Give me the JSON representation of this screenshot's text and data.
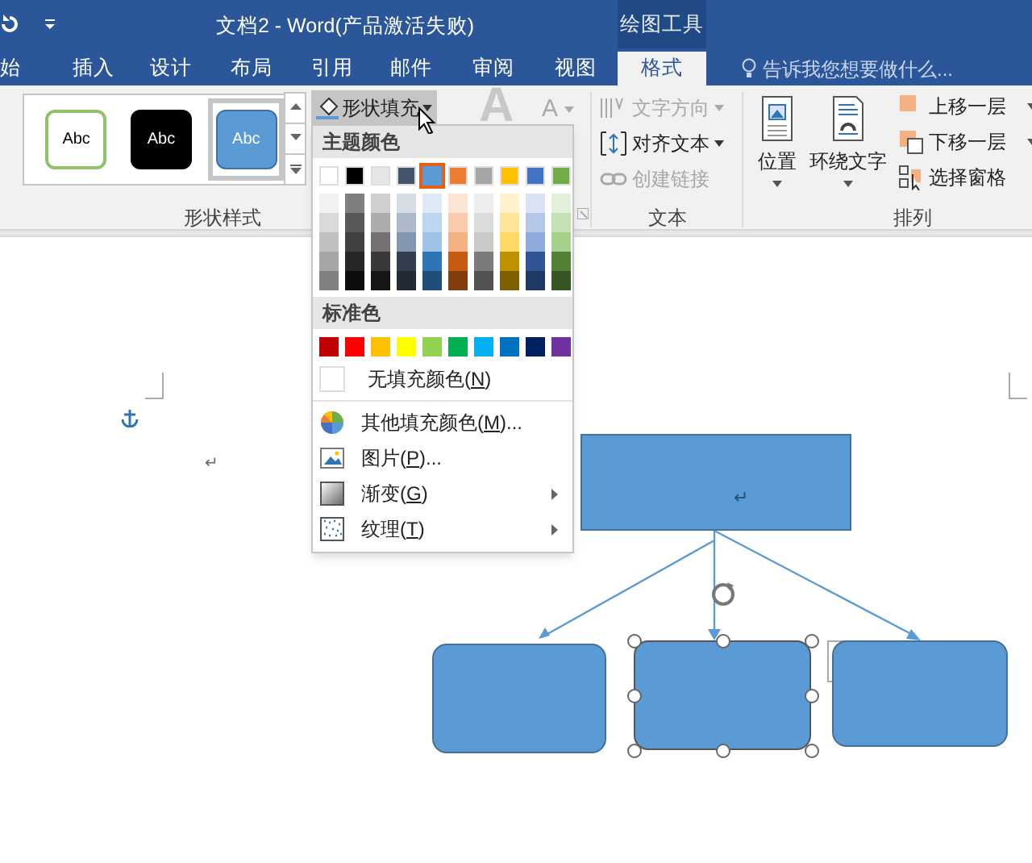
{
  "window": {
    "title": "文档2 - Word(产品激活失败)",
    "context_tab": "绘图工具"
  },
  "tabs": [
    {
      "label": "始",
      "selected": false
    },
    {
      "label": "插入",
      "selected": false
    },
    {
      "label": "设计",
      "selected": false
    },
    {
      "label": "布局",
      "selected": false
    },
    {
      "label": "引用",
      "selected": false
    },
    {
      "label": "邮件",
      "selected": false
    },
    {
      "label": "审阅",
      "selected": false
    },
    {
      "label": "视图",
      "selected": false
    },
    {
      "label": "格式",
      "selected": true
    }
  ],
  "tell_me": {
    "placeholder": "告诉我您想要做什么..."
  },
  "shape_styles": {
    "presets": [
      {
        "label": "Abc",
        "kind": "outline",
        "selected": false
      },
      {
        "label": "Abc",
        "kind": "dark",
        "selected": false
      },
      {
        "label": "Abc",
        "kind": "blue",
        "selected": true
      }
    ],
    "group_label": "形状样式"
  },
  "shape_fill": {
    "label": "形状填充"
  },
  "wordart": [
    "A",
    "A"
  ],
  "text_group": {
    "items": [
      {
        "label": "文字方向",
        "kind": "direction",
        "disabled": true,
        "dropdown": true
      },
      {
        "label": "对齐文本",
        "kind": "align",
        "disabled": false,
        "dropdown": true
      },
      {
        "label": "创建链接",
        "kind": "link",
        "disabled": true,
        "dropdown": false
      }
    ],
    "group_label": "文本"
  },
  "arrange": {
    "large": [
      {
        "label": "位置",
        "kind": "position"
      },
      {
        "label": "环绕文字",
        "kind": "wrap"
      }
    ],
    "small": [
      {
        "label": "上移一层",
        "kind": "forward",
        "dropdown": true
      },
      {
        "label": "下移一层",
        "kind": "backward",
        "dropdown": true
      },
      {
        "label": "选择窗格",
        "kind": "pane",
        "dropdown": false
      }
    ],
    "group_label": "排列"
  },
  "fill_menu": {
    "theme_heading": "主题颜色",
    "theme_colors": [
      {
        "color": "#ffffff",
        "selected": false,
        "shades": [
          {
            "color": "#f2f2f2"
          },
          {
            "color": "#d9d9d9"
          },
          {
            "color": "#bfbfbf"
          },
          {
            "color": "#a6a6a6"
          },
          {
            "color": "#808080"
          }
        ]
      },
      {
        "color": "#000000",
        "selected": false,
        "shades": [
          {
            "color": "#7f7f7f"
          },
          {
            "color": "#595959"
          },
          {
            "color": "#404040"
          },
          {
            "color": "#262626"
          },
          {
            "color": "#0d0d0d"
          }
        ]
      },
      {
        "color": "#e7e6e6",
        "selected": false,
        "shades": [
          {
            "color": "#d0cece"
          },
          {
            "color": "#aeabab"
          },
          {
            "color": "#757171"
          },
          {
            "color": "#3a3838"
          },
          {
            "color": "#171616"
          }
        ]
      },
      {
        "color": "#44546a",
        "selected": false,
        "shades": [
          {
            "color": "#d6dce4"
          },
          {
            "color": "#adb9ca"
          },
          {
            "color": "#8497b0"
          },
          {
            "color": "#333f4f"
          },
          {
            "color": "#222a35"
          }
        ]
      },
      {
        "color": "#5b9bd5",
        "selected": true,
        "shades": [
          {
            "color": "#deebf6"
          },
          {
            "color": "#bdd7ee"
          },
          {
            "color": "#9cc3e5"
          },
          {
            "color": "#2e75b5"
          },
          {
            "color": "#1f4e79"
          }
        ]
      },
      {
        "color": "#ed7d31",
        "selected": false,
        "shades": [
          {
            "color": "#fbe5d5"
          },
          {
            "color": "#f7cbac"
          },
          {
            "color": "#f4b183"
          },
          {
            "color": "#c55a11"
          },
          {
            "color": "#833c0b"
          }
        ]
      },
      {
        "color": "#a5a5a5",
        "selected": false,
        "shades": [
          {
            "color": "#ededed"
          },
          {
            "color": "#dbdbdb"
          },
          {
            "color": "#c9c9c9"
          },
          {
            "color": "#7b7b7b"
          },
          {
            "color": "#525252"
          }
        ]
      },
      {
        "color": "#ffc000",
        "selected": false,
        "shades": [
          {
            "color": "#fff2cc"
          },
          {
            "color": "#fee599"
          },
          {
            "color": "#ffd965"
          },
          {
            "color": "#bf9000"
          },
          {
            "color": "#7f6000"
          }
        ]
      },
      {
        "color": "#4472c4",
        "selected": false,
        "shades": [
          {
            "color": "#dae3f3"
          },
          {
            "color": "#b4c7e7"
          },
          {
            "color": "#8faadc"
          },
          {
            "color": "#2f5597"
          },
          {
            "color": "#203864"
          }
        ]
      },
      {
        "color": "#70ad47",
        "selected": false,
        "shades": [
          {
            "color": "#e2efd9"
          },
          {
            "color": "#c5e0b3"
          },
          {
            "color": "#a8d08d"
          },
          {
            "color": "#538135"
          },
          {
            "color": "#375623"
          }
        ]
      }
    ],
    "standard_heading": "标准色",
    "standard_colors": [
      {
        "color": "#c00000"
      },
      {
        "color": "#ff0000"
      },
      {
        "color": "#ffc000"
      },
      {
        "color": "#ffff00"
      },
      {
        "color": "#92d050"
      },
      {
        "color": "#00b050"
      },
      {
        "color": "#00b0f0"
      },
      {
        "color": "#0070c0"
      },
      {
        "color": "#002060"
      },
      {
        "color": "#7030a0"
      }
    ],
    "items": [
      {
        "kind": "no-fill",
        "label": "无填充颜色(",
        "key": "N",
        "after": ")",
        "submenu": false
      },
      {
        "kind": "more-colors",
        "label": "其他填充颜色(",
        "key": "M",
        "after": ")...",
        "submenu": false
      },
      {
        "kind": "picture",
        "label": "图片(",
        "key": "P",
        "after": ")...",
        "submenu": false
      },
      {
        "kind": "gradient",
        "label": "渐变(",
        "key": "G",
        "after": ")",
        "submenu": true
      },
      {
        "kind": "texture",
        "label": "纹理(",
        "key": "T",
        "after": ")",
        "submenu": true
      }
    ]
  },
  "document": {
    "paragraph_mark": "↵",
    "box_mark": "↵",
    "boxes": [
      {
        "selected": false
      },
      {
        "selected": true
      },
      {
        "selected": false
      }
    ]
  }
}
